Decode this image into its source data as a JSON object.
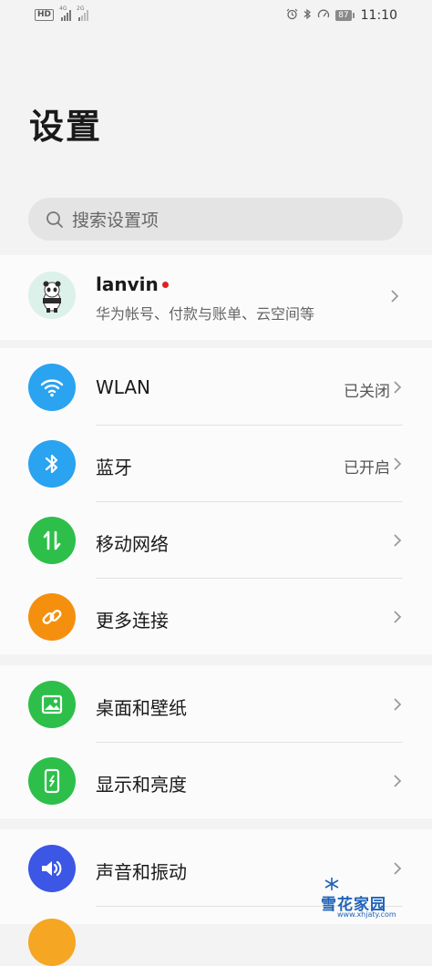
{
  "status_bar": {
    "hd": "HD",
    "sim1_tag": "4G",
    "sim2_tag": "2G",
    "battery": "87",
    "time": "11:10",
    "icons": [
      "alarm-icon",
      "bluetooth-icon",
      "data-saver-icon"
    ]
  },
  "page": {
    "title": "设置"
  },
  "search": {
    "placeholder": "搜索设置项"
  },
  "account": {
    "name": "lanvin",
    "subtitle": "华为帐号、付款与账单、云空间等",
    "has_notification": true
  },
  "groups": [
    {
      "items": [
        {
          "label": "WLAN",
          "value": "已关闭",
          "icon": "wifi-icon",
          "color": "#2aa3f0"
        },
        {
          "label": "蓝牙",
          "value": "已开启",
          "icon": "bluetooth-icon",
          "color": "#2aa3f0"
        },
        {
          "label": "移动网络",
          "value": "",
          "icon": "mobile-network-icon",
          "color": "#2dbf4a"
        },
        {
          "label": "更多连接",
          "value": "",
          "icon": "link-icon",
          "color": "#f5900f"
        }
      ]
    },
    {
      "items": [
        {
          "label": "桌面和壁纸",
          "value": "",
          "icon": "wallpaper-icon",
          "color": "#2dbf4a"
        },
        {
          "label": "显示和亮度",
          "value": "",
          "icon": "display-icon",
          "color": "#2dbf4a"
        }
      ]
    },
    {
      "items": [
        {
          "label": "声音和振动",
          "value": "",
          "icon": "sound-icon",
          "color": "#3c56e6"
        }
      ]
    }
  ],
  "watermark": {
    "text": "雪花家园",
    "url": "www.xhjaty.com"
  }
}
